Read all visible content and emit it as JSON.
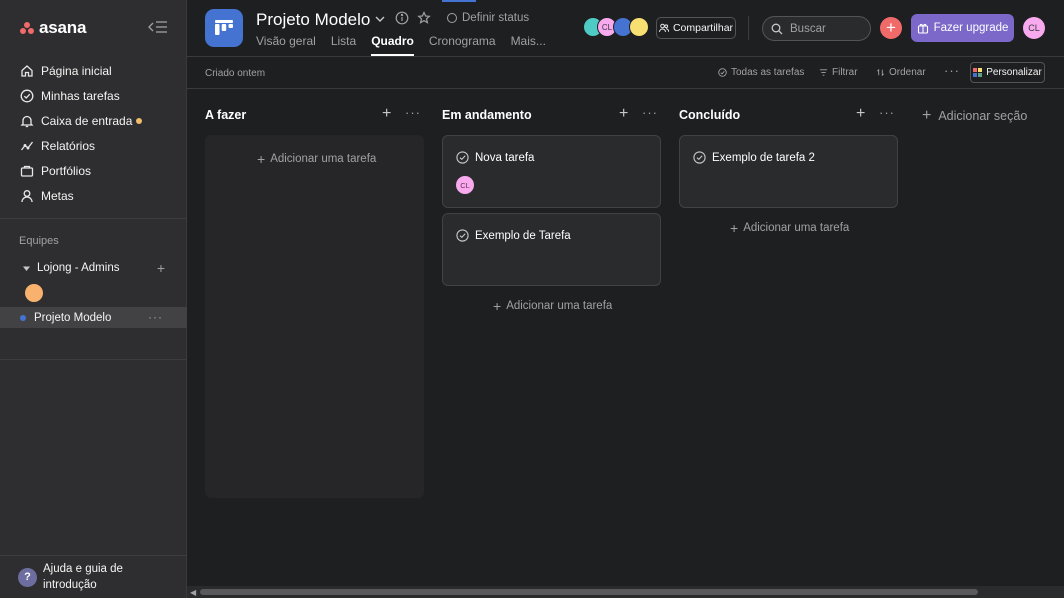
{
  "brand": {
    "name": "asana",
    "color": "#f06a6a"
  },
  "sidebar": {
    "nav": [
      {
        "label": "Página inicial",
        "icon": "home-icon"
      },
      {
        "label": "Minhas tarefas",
        "icon": "check-circle-icon"
      },
      {
        "label": "Caixa de entrada",
        "icon": "bell-icon",
        "has_notification": true
      },
      {
        "label": "Relatórios",
        "icon": "chart-icon"
      },
      {
        "label": "Portfólios",
        "icon": "folder-icon"
      },
      {
        "label": "Metas",
        "icon": "person-icon"
      }
    ],
    "teams_title": "Equipes",
    "team_name": "Lojong - Admins",
    "project_name": "Projeto Modelo",
    "help_label": "Ajuda e guia de introdução"
  },
  "header": {
    "project_title": "Projeto Modelo",
    "status_label": "Definir status",
    "tabs": [
      {
        "label": "Visão geral",
        "active": false
      },
      {
        "label": "Lista",
        "active": false
      },
      {
        "label": "Quadro",
        "active": true
      },
      {
        "label": "Cronograma",
        "active": false
      },
      {
        "label": "Mais...",
        "active": false
      }
    ],
    "member_initials": "CL",
    "share_label": "Compartilhar",
    "search_placeholder": "Buscar",
    "upgrade_label": "Fazer upgrade",
    "user_initials": "CL",
    "upgrade_color": "#7b68c9"
  },
  "toolbar": {
    "created": "Criado ontem",
    "all_tasks": "Todas as tarefas",
    "filter": "Filtrar",
    "sort": "Ordenar",
    "customize": "Personalizar"
  },
  "board": {
    "add_task_label": "Adicionar uma tarefa",
    "add_section_label": "Adicionar seção",
    "columns": [
      {
        "title": "A fazer",
        "cards": []
      },
      {
        "title": "Em andamento",
        "cards": [
          {
            "title": "Nova tarefa",
            "assignee": "CL"
          },
          {
            "title": "Exemplo de Tarefa",
            "assignee": ""
          }
        ]
      },
      {
        "title": "Concluído",
        "cards": [
          {
            "title": "Exemplo de tarefa 2",
            "assignee": ""
          }
        ]
      }
    ]
  }
}
